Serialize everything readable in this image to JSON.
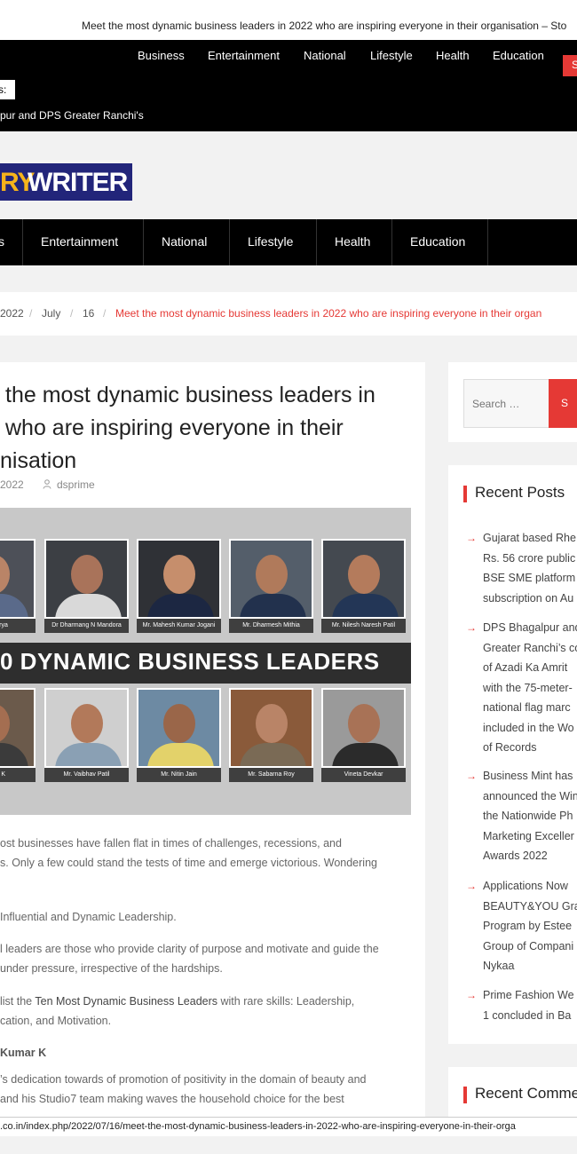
{
  "ticker": {
    "text": "Meet the most dynamic business leaders in 2022 who are inspiring everyone in their organisation – Sto"
  },
  "top_nav": {
    "items": [
      "Business",
      "Entertainment",
      "National",
      "Lifestyle",
      "Health",
      "Education"
    ],
    "search_button": "S"
  },
  "breaking": {
    "label": "s:",
    "text": "pur and DPS Greater Ranchi's"
  },
  "logo": {
    "part1": "RY",
    "part2": "WRITER",
    "colors": {
      "bg": "#22257a",
      "accent": "#f6b31b"
    }
  },
  "main_nav": {
    "items": [
      "s",
      "Entertainment",
      "National",
      "Lifestyle",
      "Health",
      "Education"
    ]
  },
  "breadcrumb": {
    "year": "2022",
    "month": "July",
    "day": "16",
    "current": "Meet the most dynamic business leaders in 2022 who are inspiring everyone in their organ"
  },
  "article": {
    "title_lines": [
      "the most dynamic business leaders in",
      "who are inspiring everyone in their",
      "nisation"
    ],
    "date": "2022",
    "author": "dsprime",
    "image": {
      "banner": "0 DYNAMIC BUSINESS LEADERS",
      "top_captions": [
        "attacharya",
        "Dr Dharmang N Mandora",
        "Mr. Mahesh Kumar Jogani",
        "Mr. Dharmesh Mithia",
        "Mr. Nilesh Naresh Patil"
      ],
      "bottom_captions": [
        "Kumar K",
        "Mr. Vaibhav Patil",
        "Mr. Nitin Jain",
        "Mr. Sabarna Roy",
        "Vineta Devkar"
      ]
    },
    "p1": [
      "ost businesses have fallen flat in times of challenges, recessions, and",
      "s. Only a few could stand the tests of time and emerge victorious. Wondering"
    ],
    "p2": "Influential and Dynamic Leadership.",
    "p3": [
      "l leaders are those who provide clarity of purpose and motivate and guide the",
      "under pressure, irrespective of the hardships."
    ],
    "p4_pre": "list the ",
    "p4_link": "Ten Most Dynamic Business Leaders",
    "p4_post": " with rare skills: Leadership,",
    "p4_line2": "cation, and Motivation.",
    "subhead": "Kumar K",
    "p5": [
      "’s dedication towards of promotion of positivity in the domain of beauty and",
      "and his Studio7 team making waves the household choice for the best"
    ]
  },
  "sidebar": {
    "search_placeholder": "Search …",
    "search_button": "S",
    "recent_posts_title": "Recent Posts",
    "recent_posts": [
      [
        "Gujarat based Rhe",
        "Rs. 56 crore public",
        "BSE SME platform",
        "subscription on Au"
      ],
      [
        "DPS Bhagalpur and",
        "Greater Ranchi’s co",
        "of Azadi Ka Amrit",
        "with the 75-meter-",
        "national flag marc",
        "included in the Wo",
        "of Records"
      ],
      [
        "Business Mint has",
        "announced the Win",
        "the Nationwide Ph",
        "Marketing Exceller",
        "Awards 2022"
      ],
      [
        "Applications Now",
        "BEAUTY&YOU Gra",
        "Program by Estee",
        "Group of Compani",
        "Nykaa"
      ],
      [
        "Prime Fashion We",
        "1 concluded in Ba"
      ]
    ],
    "recent_comments_title": "Recent Comme"
  },
  "status_bar": {
    "url": ".co.in/index.php/2022/07/16/meet-the-most-dynamic-business-leaders-in-2022-who-are-inspiring-everyone-in-their-orga"
  },
  "colors": {
    "accent": "#e53935",
    "nav_bg": "#000000",
    "page_bg": "#f2f2f2"
  }
}
